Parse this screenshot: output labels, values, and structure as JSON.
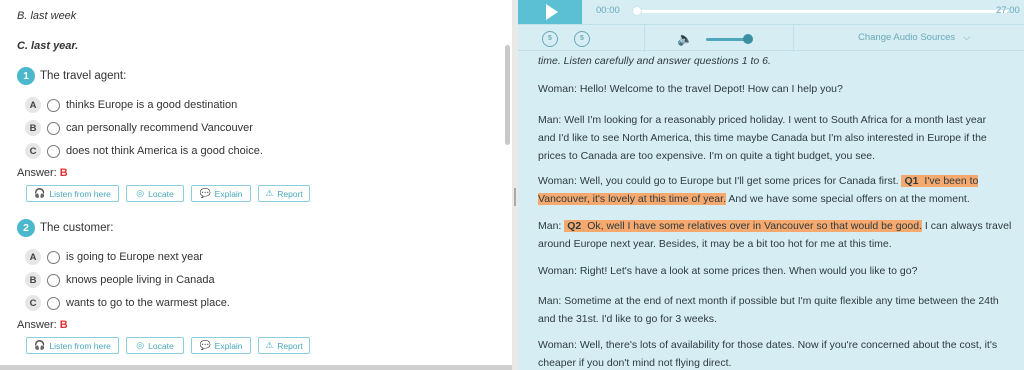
{
  "left": {
    "prev_options": [
      {
        "text": "B. last week",
        "style": "italic"
      },
      {
        "text": "C. last year.",
        "style": "bold-italic"
      }
    ],
    "questions": [
      {
        "number": "1",
        "prompt": "The travel agent:",
        "choices": [
          {
            "letter": "A",
            "text": "thinks Europe is a good destination"
          },
          {
            "letter": "B",
            "text": "can personally recommend Vancouver"
          },
          {
            "letter": "C",
            "text": "does not think America is a good choice."
          }
        ],
        "answer_label": "Answer:",
        "answer_value": "B"
      },
      {
        "number": "2",
        "prompt": "The customer:",
        "choices": [
          {
            "letter": "A",
            "text": "is going to Europe next year"
          },
          {
            "letter": "B",
            "text": "knows people living in Canada"
          },
          {
            "letter": "C",
            "text": "wants to go to the warmest place."
          }
        ],
        "answer_label": "Answer:",
        "answer_value": "B"
      }
    ],
    "actions": [
      {
        "label": "Listen from here",
        "icon": "headphones-icon"
      },
      {
        "label": "Locate",
        "icon": "locate-icon"
      },
      {
        "label": "Explain",
        "icon": "chat-icon"
      },
      {
        "label": "Report",
        "icon": "warning-icon"
      }
    ]
  },
  "player": {
    "current_time": "00:00",
    "total_time": "27:00",
    "progress": 0,
    "volume": 0.85,
    "skip_back_label": "5",
    "skip_forward_label": "5",
    "change_sources_label": "Change Audio Sources"
  },
  "transcript": {
    "intro": "time. Listen carefully and answer questions 1 to 6.",
    "p1": "Woman: Hello! Welcome to the travel Depot! How can I help you?",
    "p2_l1": "Man: Well I'm looking for a reasonably priced holiday. I went to South Africa for a month last year",
    "p2_l2": "and I'd like to see North America, this time maybe Canada but I'm also interested in Europe if the",
    "p2_l3": "prices to Canada are too expensive. I'm on quite a tight budget, you see.",
    "p3_a": "Woman: Well, you could go to Europe but I'll get some prices for Canada first. ",
    "p3_tag": "Q1",
    "p3_hl1": " I've been to",
    "p3_hl2": "Vancouver, it's lovely at this time of year.",
    "p3_b": " And we have some special offers on at the moment.",
    "p4_a": "Man: ",
    "p4_tag": "Q2",
    "p4_hl": " Ok, well I have some relatives over in Vancouver so that would be good.",
    "p4_b": " I can always travel",
    "p4_l2": "around Europe next year. Besides, it may be a bit too hot for me at this time.",
    "p5": "Woman: Right! Let's have a look at some prices then. When would you like to go?",
    "p6_l1": "Man: Sometime at the end of next month if possible but I'm quite flexible any time between the 24th",
    "p6_l2": "and the 31st. I'd like to go for 3 weeks.",
    "p7_l1": "Woman: Well, there's lots of availability for those dates. Now if you're concerned about the cost, it's",
    "p7_l2": "cheaper if you don't mind not flying direct."
  },
  "colors": {
    "accent": "#4cb8cc",
    "answer": "#e03131",
    "highlight": "#f6a96e",
    "transcript_bg": "#d6edf3"
  }
}
